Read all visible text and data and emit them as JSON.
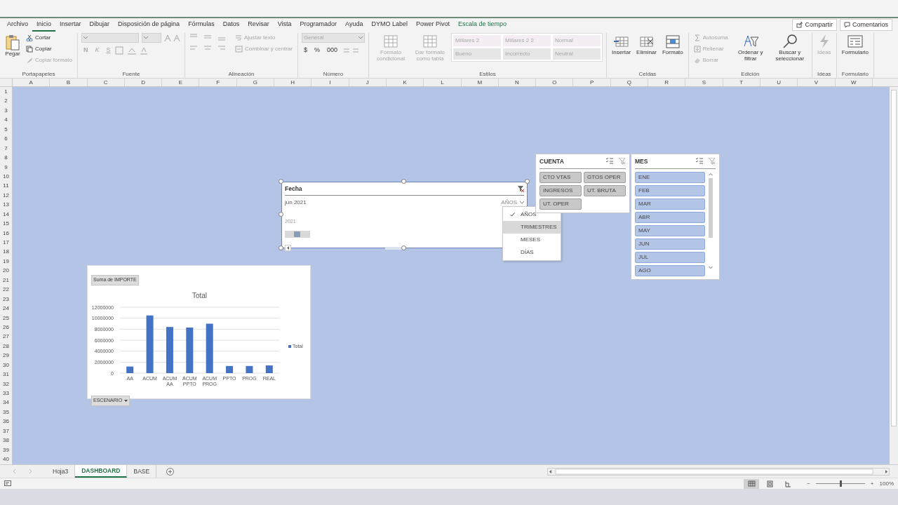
{
  "ribbon_tabs": [
    {
      "label": "Archivo",
      "selected": false,
      "kind": "standard"
    },
    {
      "label": "Inicio",
      "selected": true,
      "kind": "standard"
    },
    {
      "label": "Insertar",
      "selected": false,
      "kind": "standard"
    },
    {
      "label": "Dibujar",
      "selected": false,
      "kind": "standard"
    },
    {
      "label": "Disposición de página",
      "selected": false,
      "kind": "standard"
    },
    {
      "label": "Fórmulas",
      "selected": false,
      "kind": "standard"
    },
    {
      "label": "Datos",
      "selected": false,
      "kind": "standard"
    },
    {
      "label": "Revisar",
      "selected": false,
      "kind": "standard"
    },
    {
      "label": "Vista",
      "selected": false,
      "kind": "standard"
    },
    {
      "label": "Programador",
      "selected": false,
      "kind": "standard"
    },
    {
      "label": "Ayuda",
      "selected": false,
      "kind": "standard"
    },
    {
      "label": "DYMO Label",
      "selected": false,
      "kind": "standard"
    },
    {
      "label": "Power Pivot",
      "selected": false,
      "kind": "standard"
    },
    {
      "label": "Escala de tiempo",
      "selected": false,
      "kind": "contextual"
    }
  ],
  "share_buttons": [
    {
      "label": "Compartir"
    },
    {
      "label": "Comentarios"
    }
  ],
  "ribbon_groups": [
    {
      "label": "Portapapeles",
      "items": [
        {
          "kind": "large",
          "label": "Pegar",
          "disabled": false
        },
        {
          "kind": "small",
          "label": "Cortar",
          "disabled": false
        },
        {
          "kind": "small",
          "label": "Copiar",
          "disabled": false
        },
        {
          "kind": "small",
          "label": "Copiar formato",
          "disabled": true
        }
      ]
    },
    {
      "label": "Fuente",
      "items": [
        {
          "kind": "combo",
          "disabled": true
        },
        {
          "kind": "combo",
          "disabled": true
        },
        {
          "kind": "glyph",
          "label": "N",
          "disabled": true
        },
        {
          "kind": "glyph",
          "label": "K",
          "disabled": true
        },
        {
          "kind": "glyph",
          "label": "S",
          "disabled": true
        }
      ]
    },
    {
      "label": "Alineación",
      "items": [
        {
          "kind": "small",
          "label": "Ajustar texto",
          "disabled": true
        },
        {
          "kind": "small",
          "label": "Combinar y centrar",
          "disabled": true
        }
      ]
    },
    {
      "label": "Número",
      "items": [
        {
          "kind": "combo",
          "label": "General",
          "disabled": true
        },
        {
          "kind": "glyph",
          "label": "$",
          "disabled": true
        },
        {
          "kind": "glyph",
          "label": "%",
          "disabled": true
        },
        {
          "kind": "glyph",
          "label": "000",
          "disabled": true
        }
      ]
    },
    {
      "label": "Estilos",
      "items": [
        {
          "kind": "large",
          "label": "Formato condicional",
          "disabled": true
        },
        {
          "kind": "large",
          "label": "Dar formato como tabla",
          "disabled": true
        }
      ],
      "styles": [
        {
          "label": "Millares 2",
          "disabled": true
        },
        {
          "label": "Millares 2 2",
          "disabled": true
        },
        {
          "label": "Normal",
          "disabled": true
        },
        {
          "label": "Bueno",
          "disabled": true
        },
        {
          "label": "Incorrecto",
          "disabled": true
        },
        {
          "label": "Neutral",
          "disabled": true
        }
      ]
    },
    {
      "label": "Celdas",
      "items": [
        {
          "kind": "large",
          "label": "Insertar",
          "disabled": false
        },
        {
          "kind": "large",
          "label": "Eliminar",
          "disabled": false
        },
        {
          "kind": "large",
          "label": "Formato",
          "disabled": false
        }
      ]
    },
    {
      "label": "Edición",
      "items": [
        {
          "kind": "small",
          "label": "Autosuma",
          "disabled": true
        },
        {
          "kind": "small",
          "label": "Rellenar",
          "disabled": true
        },
        {
          "kind": "small",
          "label": "Borrar",
          "disabled": true
        },
        {
          "kind": "large",
          "label": "Ordenar y filtrar",
          "disabled": false
        },
        {
          "kind": "large",
          "label": "Buscar y seleccionar",
          "disabled": false
        }
      ]
    },
    {
      "label": "Ideas",
      "items": [
        {
          "kind": "large",
          "label": "Ideas",
          "disabled": true
        }
      ]
    },
    {
      "label": "Formulario",
      "items": [
        {
          "kind": "large",
          "label": "Formulario",
          "disabled": false
        }
      ]
    }
  ],
  "column_headers": [
    "A",
    "B",
    "C",
    "D",
    "E",
    "F",
    "G",
    "H",
    "I",
    "J",
    "K",
    "L",
    "M",
    "N",
    "O",
    "P",
    "Q",
    "R",
    "S",
    "T",
    "U",
    "V",
    "W"
  ],
  "row_headers": [
    "1",
    "2",
    "3",
    "4",
    "5",
    "6",
    "7",
    "8",
    "9",
    "10",
    "11",
    "12",
    "13",
    "14",
    "15",
    "16",
    "17",
    "18",
    "19",
    "20",
    "21",
    "22",
    "23",
    "24",
    "25",
    "26",
    "27",
    "28",
    "29",
    "30",
    "31",
    "32",
    "33",
    "34",
    "35",
    "36",
    "37",
    "38",
    "39",
    "40"
  ],
  "timeline": {
    "title": "Fecha",
    "selection": "jun 2021",
    "level": "AÑOS",
    "year": "2021",
    "menu": [
      {
        "label": "AÑOS",
        "checked": true,
        "highlighted": false
      },
      {
        "label": "TRIMESTRES",
        "checked": false,
        "highlighted": true
      },
      {
        "label": "MESES",
        "checked": false,
        "highlighted": false
      },
      {
        "label": "DÍAS",
        "checked": false,
        "highlighted": false
      }
    ]
  },
  "slicers": [
    {
      "title": "CUENTA",
      "kind": "grid",
      "items": [
        {
          "label": "CTO VTAS",
          "selected": false
        },
        {
          "label": "GTOS OPER",
          "selected": false
        },
        {
          "label": "INGRESOS",
          "selected": false
        },
        {
          "label": "UT. BRUTA",
          "selected": false
        },
        {
          "label": "UT. OPER",
          "selected": false
        }
      ]
    },
    {
      "title": "MES",
      "kind": "list",
      "items": [
        {
          "label": "ENE",
          "selected": true
        },
        {
          "label": "FEB",
          "selected": true
        },
        {
          "label": "MAR",
          "selected": true
        },
        {
          "label": "ABR",
          "selected": true
        },
        {
          "label": "MAY",
          "selected": true
        },
        {
          "label": "JUN",
          "selected": true
        },
        {
          "label": "JUL",
          "selected": true
        },
        {
          "label": "AGO",
          "selected": true
        }
      ]
    }
  ],
  "pivot_chart": {
    "value_field": "Suma de IMPORTE",
    "axis_field": "ESCENARIO",
    "chart_data": {
      "type": "bar",
      "title": "Total",
      "categories": [
        "AA",
        "ACUM",
        "ACUM AA",
        "ACUM PPTO",
        "ACUM PROG",
        "PPTO",
        "PROG",
        "REAL"
      ],
      "series": [
        {
          "name": "Total",
          "color": "#4472c4",
          "values": [
            1200000,
            10500000,
            8400000,
            8300000,
            9000000,
            1300000,
            1300000,
            1400000
          ]
        }
      ],
      "grid": true,
      "ylim": [
        0,
        12000000
      ],
      "yticks": [
        0,
        2000000,
        4000000,
        6000000,
        8000000,
        10000000,
        12000000
      ]
    }
  },
  "sheet_tabs": [
    {
      "label": "Hoja3",
      "selected": false
    },
    {
      "label": "DASHBOARD",
      "selected": true
    },
    {
      "label": "BASE",
      "selected": false
    }
  ],
  "status_bar": {
    "views": [
      {
        "selected": true
      },
      {
        "selected": false
      },
      {
        "selected": false
      }
    ],
    "zoom": {
      "minus": "−",
      "plus": "+",
      "level": 0.5,
      "reading": "100%"
    }
  }
}
